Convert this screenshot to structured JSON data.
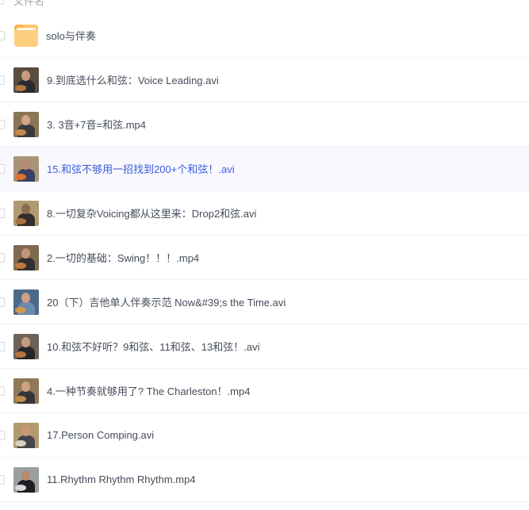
{
  "header": {
    "column_label": "文件名"
  },
  "colors": {
    "hover_bg": "#f8f8fe",
    "hover_text": "#3b5bdb",
    "text": "#454d5a",
    "folder": "#ffc46b"
  },
  "files": [
    {
      "name": "solo与伴奏",
      "type": "folder",
      "icon": "folder-icon"
    },
    {
      "name": "9.到底选什么和弦：Voice Leading.avi",
      "type": "video",
      "icon": "video-thumbnail",
      "thumb": {
        "bg": "#5a4c3e",
        "head": "#c79a7a",
        "body": "#2a2a30",
        "guitar": "#b5783c"
      }
    },
    {
      "name": "3. 3音+7音=和弦.mp4",
      "type": "video",
      "icon": "video-thumbnail",
      "thumb": {
        "bg": "#8a7556",
        "head": "#d2a585",
        "body": "#3a3a3e",
        "guitar": "#c08a4a"
      }
    },
    {
      "name": "15.和弦不够用一招找到200+个和弦！.avi",
      "type": "video",
      "icon": "video-thumbnail",
      "hover": true,
      "thumb": {
        "bg": "#a89478",
        "head": "#b98b6e",
        "body": "#3d4060",
        "guitar": "#e0702a"
      }
    },
    {
      "name": "8.一切复杂Voicing都从这里来：Drop2和弦.avi",
      "type": "video",
      "icon": "video-thumbnail",
      "thumb": {
        "bg": "#b09a70",
        "head": "#8e6a52",
        "body": "#332e2a",
        "guitar": "#a57040"
      }
    },
    {
      "name": "2.一切的基础：Swing！！！.mp4",
      "type": "video",
      "icon": "video-thumbnail",
      "thumb": {
        "bg": "#7d6a50",
        "head": "#c49478",
        "body": "#2f2f33",
        "guitar": "#c07a3a"
      }
    },
    {
      "name": "20（下）吉他单人伴奏示范 Now&#39;s the Time.avi",
      "type": "video",
      "icon": "video-thumbnail",
      "thumb": {
        "bg": "#4a6a8a",
        "head": "#d0a080",
        "body": "#6a8ab0",
        "guitar": "#d09a4a"
      }
    },
    {
      "name": "10.和弦不好听？9和弦、11和弦、13和弦！.avi",
      "type": "video",
      "icon": "video-thumbnail",
      "thumb": {
        "bg": "#6e6258",
        "head": "#c69a7c",
        "body": "#262628",
        "guitar": "#b4783a"
      }
    },
    {
      "name": "4.一种节奏就够用了? The Charleston！.mp4",
      "type": "video",
      "icon": "video-thumbnail",
      "thumb": {
        "bg": "#8e7858",
        "head": "#cfa082",
        "body": "#353538",
        "guitar": "#c48a48"
      }
    },
    {
      "name": "17.Person Comping.avi",
      "type": "video",
      "icon": "video-thumbnail",
      "thumb": {
        "bg": "#b39a6e",
        "head": "#c99878",
        "body": "#45464c",
        "guitar": "#d8d0c0"
      }
    },
    {
      "name": "11.Rhythm Rhythm Rhythm.mp4",
      "type": "video",
      "icon": "video-thumbnail",
      "thumb": {
        "bg": "#9aa0a0",
        "head": "#b88a6c",
        "body": "#1e1e24",
        "guitar": "#d8d8d8"
      }
    }
  ]
}
